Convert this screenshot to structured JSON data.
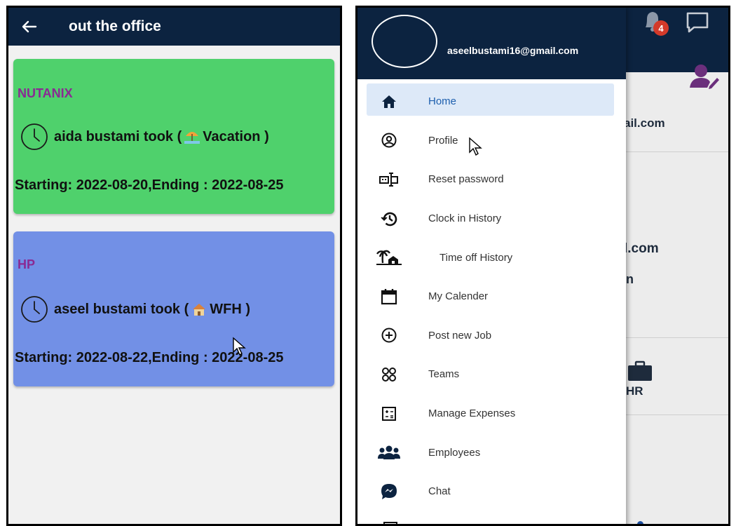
{
  "left_screen": {
    "header": {
      "title": "out the office",
      "back_icon": "arrow-left-icon"
    },
    "cards": [
      {
        "company": "NUTANIX",
        "person_text": "aida bustami took (",
        "type_label": "Vacation )",
        "dates": "Starting: 2022-08-20,Ending : 2022-08-25",
        "bg_color": "#4fd16c"
      },
      {
        "company": "HP",
        "person_text": "aseel bustami took (",
        "type_label": "WFH )",
        "dates": "Starting: 2022-08-22,Ending : 2022-08-25",
        "bg_color": "#7290e6"
      }
    ]
  },
  "right_screen": {
    "notification_count": "4",
    "background_texts": [
      "ail.com",
      "l.com",
      "n",
      "HR"
    ],
    "drawer": {
      "email": "aseelbustami16@gmail.com",
      "menu": [
        {
          "label": "Home",
          "icon": "home-icon"
        },
        {
          "label": "Profile",
          "icon": "profile-icon"
        },
        {
          "label": "Reset password",
          "icon": "reset-password-icon"
        },
        {
          "label": "Clock in History",
          "icon": "history-icon"
        },
        {
          "label": "Time off History",
          "icon": "beach-icon"
        },
        {
          "label": "My Calender",
          "icon": "calendar-icon"
        },
        {
          "label": "Post new Job",
          "icon": "add-circle-icon"
        },
        {
          "label": "Teams",
          "icon": "teams-icon"
        },
        {
          "label": "Manage Expenses",
          "icon": "calculator-icon"
        },
        {
          "label": "Employees",
          "icon": "employees-icon"
        },
        {
          "label": "Chat",
          "icon": "messenger-icon"
        }
      ]
    }
  }
}
